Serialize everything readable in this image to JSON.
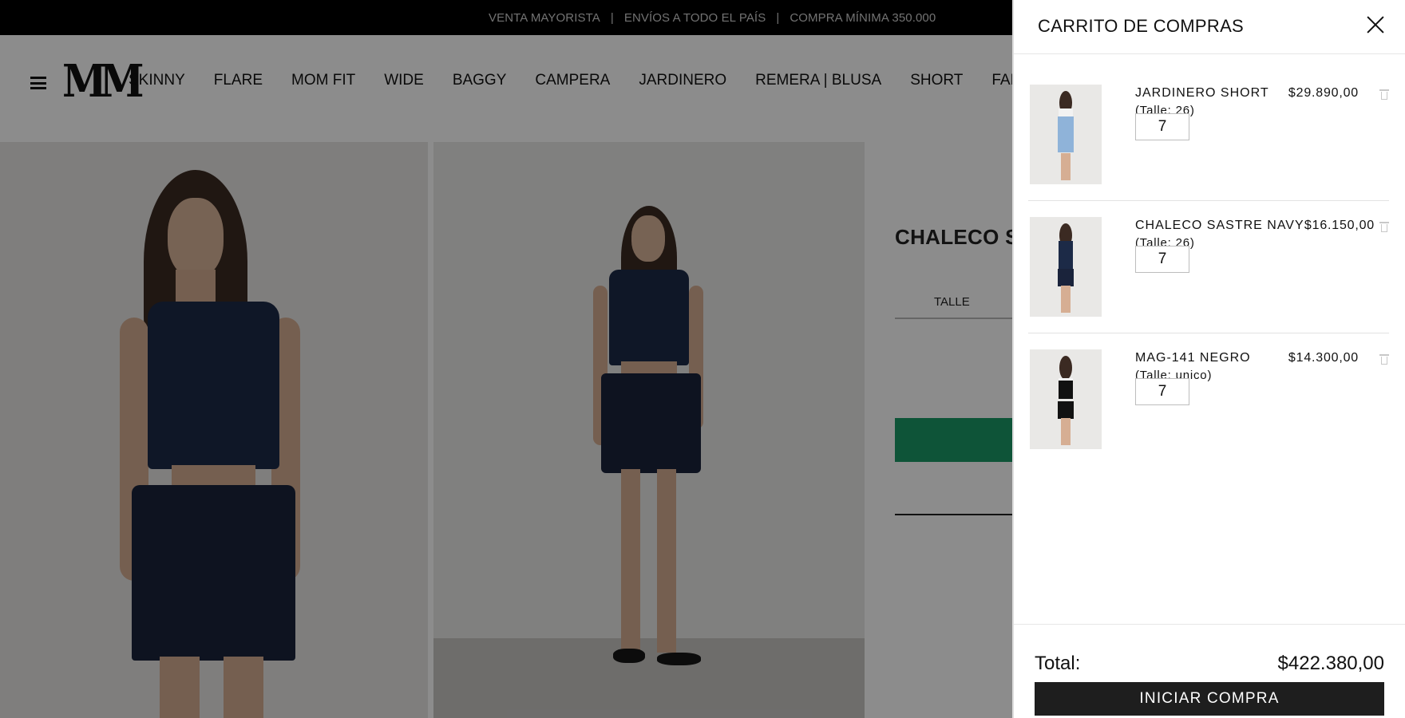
{
  "announcement": {
    "item1": "VENTA MAYORISTA",
    "item2": "ENVÍOS A TODO EL PAÍS",
    "item3": "COMPRA MÍNIMA 350.000",
    "separator": "|"
  },
  "header": {
    "logo": "MM",
    "menu_icon": "hamburger-icon",
    "nav": [
      "SKINNY",
      "FLARE",
      "MOM FIT",
      "WIDE",
      "BAGGY",
      "CAMPERA",
      "JARDINERO",
      "REMERA | BLUSA",
      "SHORT",
      "FALDA"
    ]
  },
  "product": {
    "title": "CHALECO SA",
    "size_label": "TALLE",
    "buy_button_color": "#1a9a66"
  },
  "cart": {
    "title": "CARRITO DE COMPRAS",
    "close_icon": "close-icon",
    "items": [
      {
        "name": "JARDINERO SHORT",
        "size": "(Talle: 26)",
        "price": "$29.890,00",
        "quantity": "7"
      },
      {
        "name": "CHALECO SASTRE NAVY",
        "size": "(Talle: 26)",
        "price": "$16.150,00",
        "quantity": "7"
      },
      {
        "name": "MAG-141 NEGRO",
        "size": "(Talle: unico)",
        "price": "$14.300,00",
        "quantity": "7"
      }
    ],
    "total_label": "Total:",
    "total_value": "$422.380,00",
    "checkout_label": "INICIAR COMPRA"
  }
}
